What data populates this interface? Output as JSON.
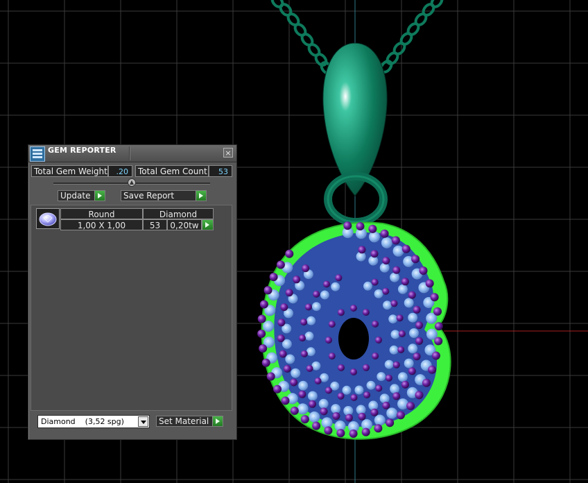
{
  "window": {
    "title": "GEM REPORTER",
    "close_glyph": "×"
  },
  "summary": {
    "weight_label": "Total Gem Weight",
    "weight_value": ".20",
    "count_label": "Total Gem Count",
    "count_value": "53"
  },
  "actions": {
    "update_label": "Update",
    "save_label": "Save Report"
  },
  "gems_table": {
    "headers": [
      "Round",
      "Diamond"
    ],
    "rows": [
      {
        "shape_icon": "round-gem-icon",
        "size": "1,00 X 1,00",
        "count": "53",
        "weight": "0,20tw"
      }
    ]
  },
  "material": {
    "selected": "Diamond    (3,52 spg)",
    "set_label": "Set Material"
  },
  "colors": {
    "panel_bg": "#575757",
    "value_text": "#7fd6ff",
    "accent_green": "#3aa53a",
    "grid_line": "#3a3a3a",
    "pendant_metal": "#0e7a5c",
    "pendant_outline": "#3df03d",
    "gem_light": "#8db8ef",
    "gem_purple": "#5a1a8a"
  }
}
